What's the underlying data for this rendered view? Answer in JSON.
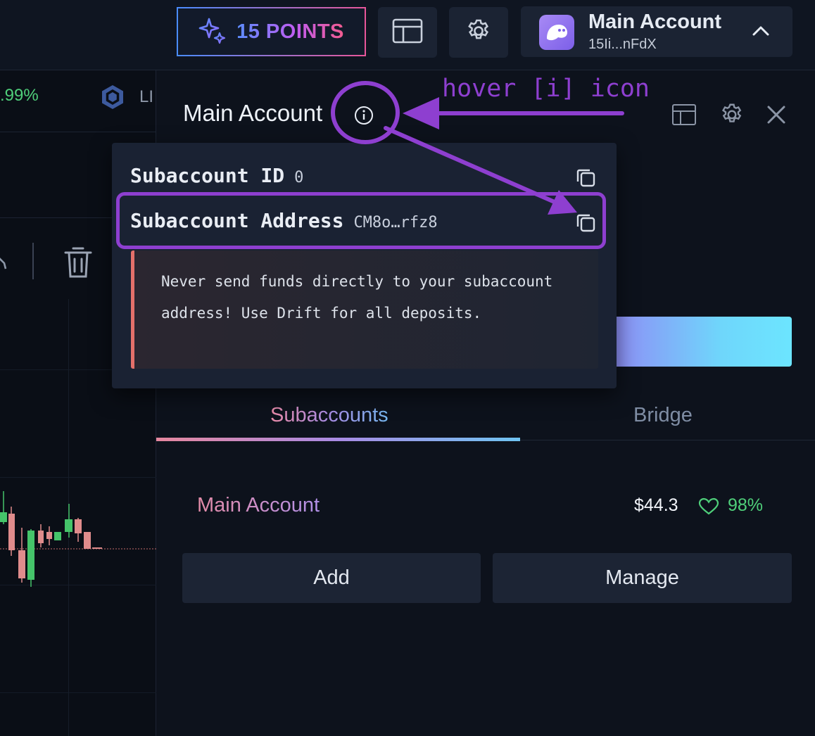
{
  "topbar": {
    "points_label": "15 POINTS",
    "layout_icon": "layout-icon",
    "settings_icon": "gear-icon",
    "account": {
      "name": "Main Account",
      "address": "15Ii...nFdX",
      "avatar_icon": "ghost-avatar-icon",
      "chevron_icon": "chevron-up-icon"
    }
  },
  "left": {
    "percent": ".99%",
    "token_label": "LI",
    "trash_icon": "trash-icon"
  },
  "panel": {
    "title": "Main Account",
    "info_icon": "info-icon",
    "tabs": [
      {
        "label": "Subaccounts",
        "active": true
      },
      {
        "label": "Bridge",
        "active": false
      }
    ],
    "subaccount_row": {
      "name": "Main Account",
      "value": "$44.3",
      "health": "98%",
      "health_icon": "heart-icon"
    },
    "buttons": {
      "add": "Add",
      "manage": "Manage"
    }
  },
  "tooltip": {
    "id_label": "Subaccount ID",
    "id_value": "0",
    "address_label": "Subaccount Address",
    "address_value": "CM8o…rfz8",
    "warning": "Never send funds directly to your subaccount address! Use Drift for all deposits."
  },
  "annotation": {
    "label": "hover [i] icon"
  },
  "colors": {
    "accent_purple": "#8e3fd0",
    "positive_green": "#4fcf7a",
    "warning_red": "#e4706a",
    "background": "#0b1019"
  }
}
